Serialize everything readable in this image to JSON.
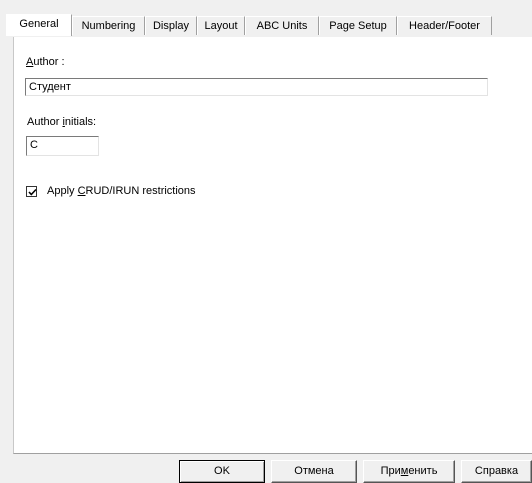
{
  "tabs": [
    {
      "label": "General",
      "active": true
    },
    {
      "label": "Numbering",
      "active": false
    },
    {
      "label": "Display",
      "active": false
    },
    {
      "label": "Layout",
      "active": false
    },
    {
      "label": "ABC Units",
      "active": false
    },
    {
      "label": "Page Setup",
      "active": false
    },
    {
      "label": "Header/Footer",
      "active": false
    }
  ],
  "general": {
    "author_label_mnemonic": "A",
    "author_label_rest": "uthor :",
    "author_value": "Студент",
    "initials_label_pre": "Author ",
    "initials_label_mnemonic": "i",
    "initials_label_rest": "nitials:",
    "initials_value": "C",
    "apply_crud_checked": true,
    "apply_crud_pre": "Apply ",
    "apply_crud_mnemonic": "C",
    "apply_crud_rest": "RUD/IRUN restrictions"
  },
  "buttons": {
    "ok": "OK",
    "cancel": "Отмена",
    "apply_pre": "При",
    "apply_mnemonic": "м",
    "apply_rest": "енить",
    "help": "Справка"
  }
}
